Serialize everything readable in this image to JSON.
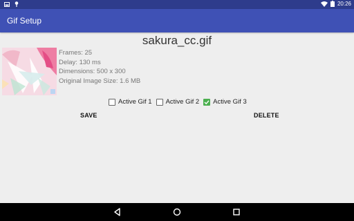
{
  "status_bar": {
    "time": "20:26",
    "icons": [
      "notification-image-icon",
      "notification-pin-icon",
      "wifi-icon",
      "battery-icon"
    ]
  },
  "app_bar": {
    "title": "Gif Setup",
    "color": "#3f51b5",
    "status_color": "#2e3c8c"
  },
  "gif": {
    "filename": "sakura_cc.gif",
    "frames": "Frames: 25",
    "delay": "Delay:  130 ms",
    "dimensions": "Dimensions: 500 x 300",
    "original_size": "Original Image Size: 1.6 MB"
  },
  "active_gifs": [
    {
      "label": "Active Gif 1",
      "checked": false
    },
    {
      "label": "Active Gif 2",
      "checked": false
    },
    {
      "label": "Active Gif 3",
      "checked": true
    }
  ],
  "buttons": {
    "save": "SAVE",
    "delete": "DELETE"
  },
  "nav": {
    "icons": [
      "back-icon",
      "home-icon",
      "recents-icon"
    ]
  },
  "colors": {
    "checkbox_checked": "#4caf50",
    "background": "#eeeeee"
  }
}
